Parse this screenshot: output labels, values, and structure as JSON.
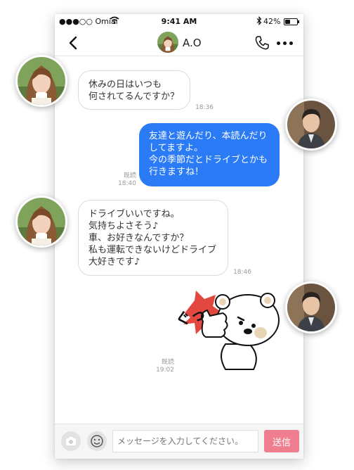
{
  "status_bar": {
    "carrier": "●●●○○ Omiai",
    "time": "9:41 AM",
    "battery": "42%",
    "battery_level": 0.42
  },
  "header": {
    "contact_name": "A.O"
  },
  "messages": [
    {
      "lines": [
        "休みの日はいつも",
        "何されてるんですか？"
      ],
      "time": "18:36"
    },
    {
      "lines": [
        "友達と遊んだり、本読んだり",
        "してますよ。",
        "今の季節だとドライブとかも",
        "行きますね！"
      ],
      "read": "既読",
      "time": "18:40"
    },
    {
      "lines": [
        "ドライブいいですね。",
        "気持ちよさそう♪",
        "車、お好きなんですか？",
        "私も運転できないけどドライブ",
        "大好きです♪"
      ],
      "time": "18:46"
    },
    {
      "sticker": "bear-thumbs-up-sticker",
      "sticker_text": "ぐっ",
      "read": "既読",
      "time": "19:02"
    }
  ],
  "composer": {
    "placeholder": "メッセージを入力してください。",
    "send_label": "送信"
  },
  "colors": {
    "outgoing_bubble": "#2b7af6",
    "send_button": "#ef7f8e"
  }
}
